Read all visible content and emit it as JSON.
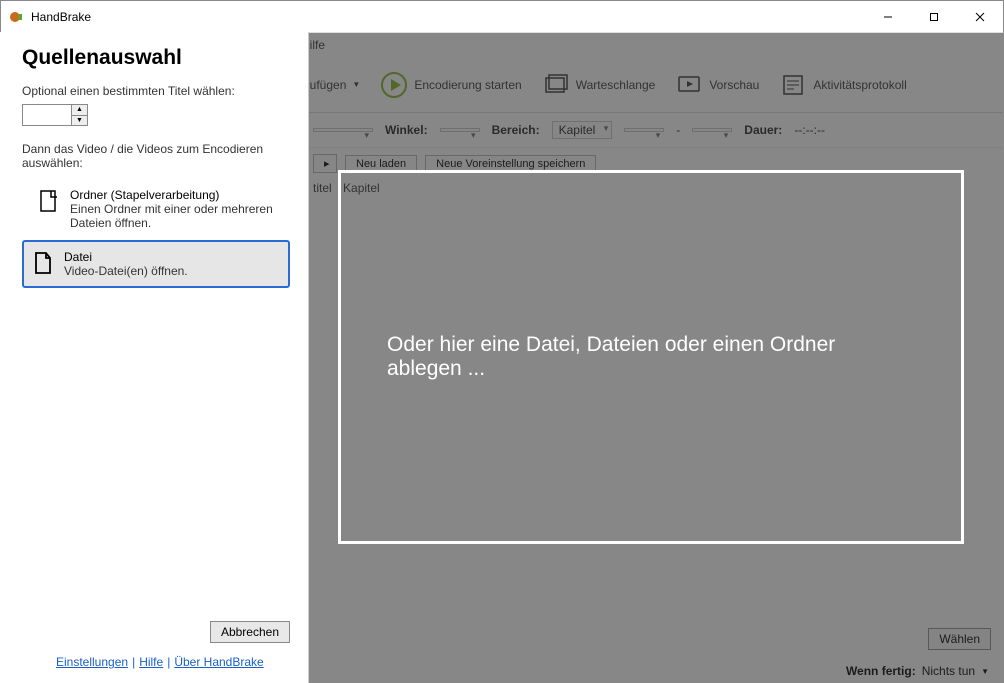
{
  "titlebar": {
    "title": "HandBrake"
  },
  "menubar": {
    "help": "Hilfe"
  },
  "toolbar": {
    "add": "nzufügen",
    "start": "Encodierung starten",
    "queue": "Warteschlange",
    "preview": "Vorschau",
    "activity": "Aktivitätsprotokoll"
  },
  "params": {
    "angle_label": "Winkel:",
    "range_label": "Bereich:",
    "range_value": "Kapitel",
    "dash": "-",
    "duration_label": "Dauer:",
    "duration_value": "--:--:--"
  },
  "preset": {
    "arrow": "▸",
    "reload": "Neu laden",
    "save": "Neue Voreinstellung speichern"
  },
  "tabs": {
    "title": "titel",
    "chapters": "Kapitel"
  },
  "bottom": {
    "choose": "Wählen"
  },
  "status": {
    "label": "Wenn fertig:",
    "value": "Nichts tun"
  },
  "dropzone": {
    "msg": "Oder hier eine Datei, Dateien oder einen Ordner ablegen ..."
  },
  "side": {
    "heading": "Quellenauswahl",
    "optional_hint": "Optional einen bestimmten Titel wählen:",
    "then_hint": "Dann das Video / die Videos zum Encodieren auswählen:",
    "folder": {
      "title": "Ordner (Stapelverarbeitung)",
      "desc": "Einen Ordner mit einer oder mehreren Dateien öffnen."
    },
    "file": {
      "title": "Datei",
      "desc": "Video-Datei(en) öffnen."
    },
    "cancel": "Abbrechen",
    "links": {
      "settings": "Einstellungen",
      "help": "Hilfe",
      "about": "Über HandBrake"
    }
  }
}
